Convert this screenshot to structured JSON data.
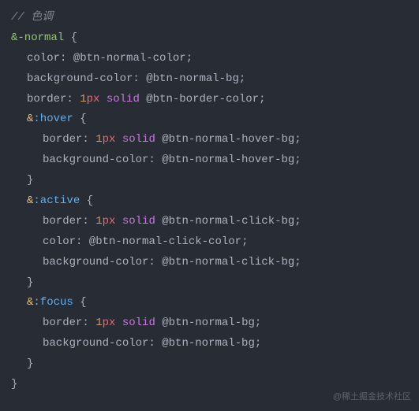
{
  "comment": "// 色调",
  "sel_normal": "&-normal",
  "brace_open": " {",
  "brace_close": "}",
  "p_color": "color",
  "p_bg": "background-color",
  "p_border": "border",
  "colon": ": ",
  "semi": ";",
  "border_val_num": "1",
  "border_val_unit": "px",
  "border_val_solid": " solid ",
  "v_normal_color": "@btn-normal-color",
  "v_normal_bg": "@btn-normal-bg",
  "v_border_color": "@btn-border-color",
  "v_hover_bg": "@btn-normal-hover-bg",
  "v_click_bg": "@btn-normal-click-bg",
  "v_click_color": "@btn-normal-click-color",
  "amp": "&",
  "ps_hover": ":hover",
  "ps_active": ":active",
  "ps_focus": ":focus",
  "watermark": "@稀土掘金技术社区"
}
